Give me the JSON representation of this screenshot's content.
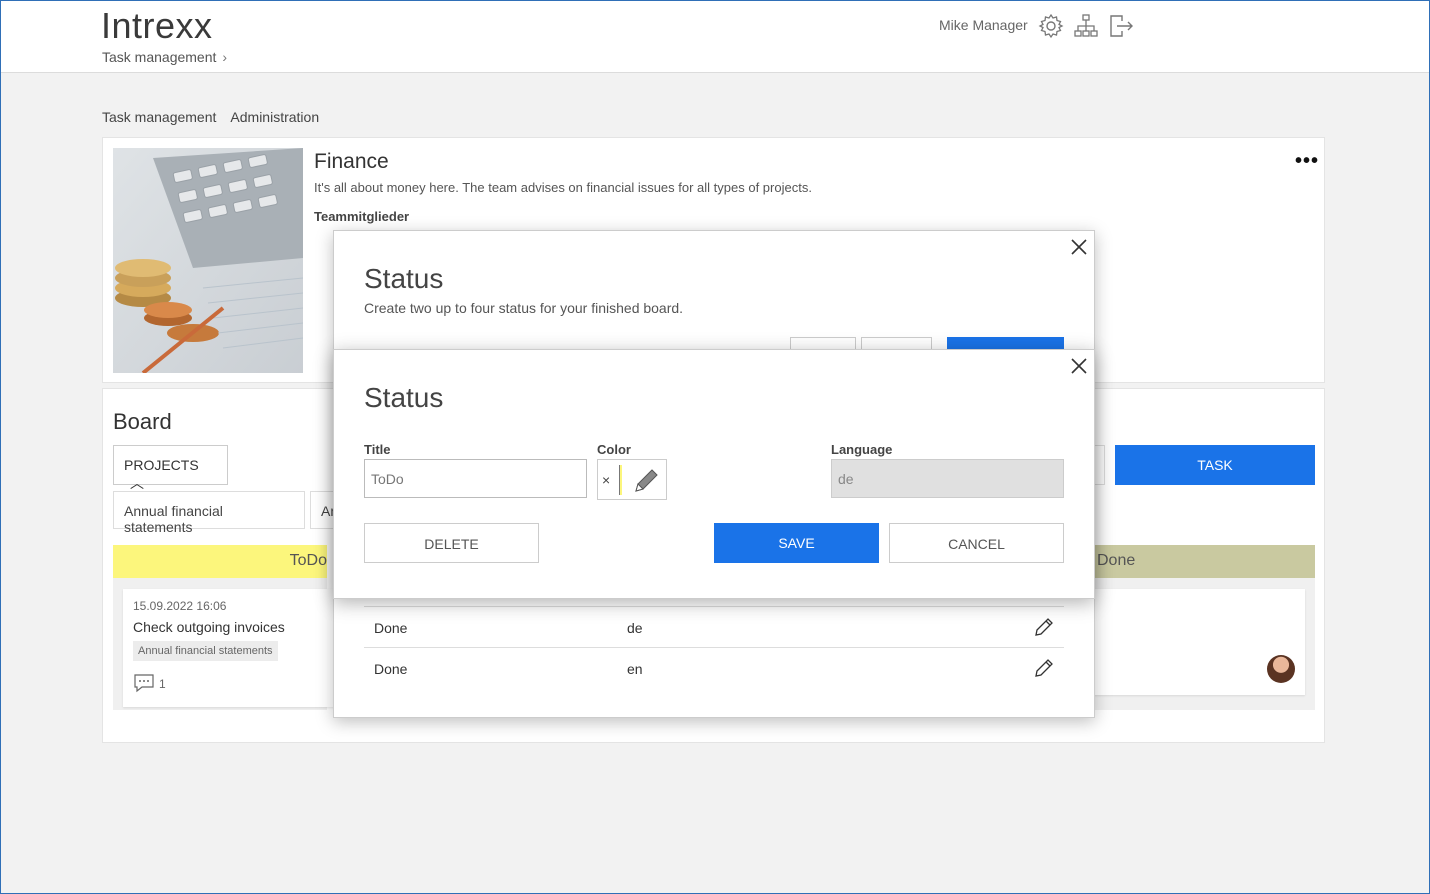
{
  "header": {
    "logo": "Intrexx",
    "breadcrumb": "Task management",
    "user": "Mike Manager",
    "icons": [
      "gear-icon",
      "sitemap-icon",
      "logout-icon"
    ]
  },
  "subnav": [
    "Task management",
    "Administration"
  ],
  "finance": {
    "title": "Finance",
    "description": "It's all about money here. The team advises on financial issues for all types of projects.",
    "members_label": "Teammitglieder",
    "more": "•••"
  },
  "board": {
    "title": "Board",
    "projects_label": "PROJECTS",
    "filters": [
      "Annual financial statements",
      "An"
    ],
    "task_button": "TASK",
    "columns": [
      {
        "name": "ToDo",
        "color": "#fcf67c"
      },
      {
        "name": "Done",
        "color": "#c9c9a0"
      }
    ],
    "task_card": {
      "date": "15.09.2022 16:06",
      "title": "Check outgoing invoices",
      "tag": "Annual financial statements",
      "comments": "1"
    }
  },
  "dialog_back": {
    "title": "Status",
    "description": "Create two up to four status for your finished board.",
    "rows": [
      {
        "title": "Done",
        "language": "de"
      },
      {
        "title": "Done",
        "language": "en"
      }
    ]
  },
  "dialog_front": {
    "title": "Status",
    "title_label": "Title",
    "title_value": "ToDo",
    "color_label": "Color",
    "color_value": "#fcf67c",
    "color_clear": "×",
    "language_label": "Language",
    "language_value": "de",
    "delete_label": "DELETE",
    "save_label": "SAVE",
    "cancel_label": "CANCEL"
  }
}
